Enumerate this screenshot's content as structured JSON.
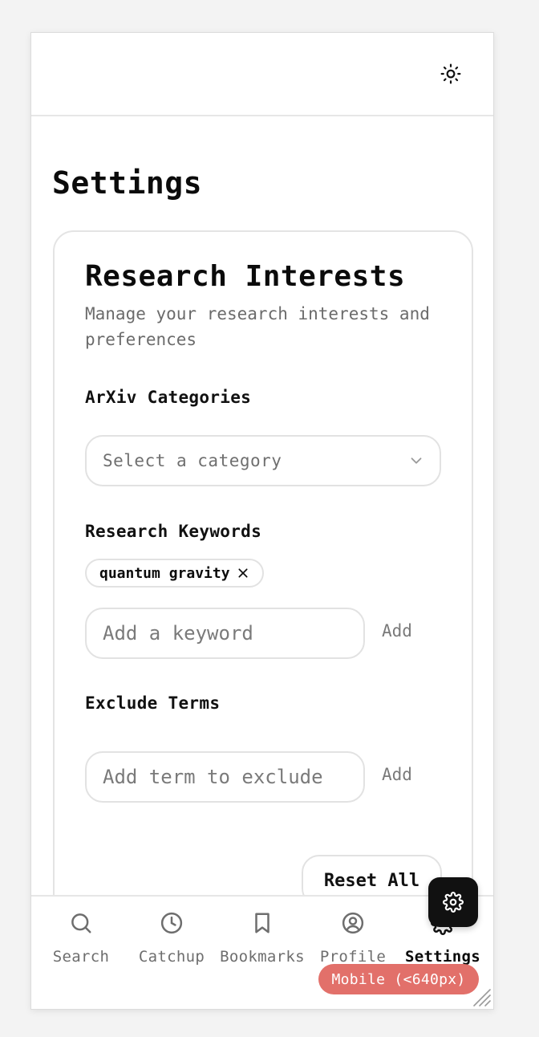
{
  "page": {
    "title": "Settings"
  },
  "topbar": {
    "theme_toggle_icon": "sun-icon"
  },
  "card": {
    "title": "Research Interests",
    "description": "Manage your research interests and preferences"
  },
  "categories": {
    "label": "ArXiv Categories",
    "select_placeholder": "Select a category",
    "select_icon": "chevron-down-icon"
  },
  "keywords": {
    "label": "Research Keywords",
    "chips": [
      {
        "label": "quantum gravity",
        "remove_icon": "close-icon"
      }
    ],
    "input_placeholder": "Add a keyword",
    "input_value": "",
    "add_label": "Add"
  },
  "exclude": {
    "label": "Exclude Terms",
    "input_placeholder": "Add term to exclude",
    "input_value": "",
    "add_label": "Add"
  },
  "actions": {
    "reset_label": "Reset All"
  },
  "bottom_nav": {
    "items": [
      {
        "label": "Search",
        "icon": "search-icon",
        "active": false
      },
      {
        "label": "Catchup",
        "icon": "clock-icon",
        "active": false
      },
      {
        "label": "Bookmarks",
        "icon": "bookmark-icon",
        "active": false
      },
      {
        "label": "Profile",
        "icon": "user-circle-icon",
        "active": false
      },
      {
        "label": "Settings",
        "icon": "gear-icon",
        "active": true
      }
    ]
  },
  "fab": {
    "icon": "gear-icon"
  },
  "viewport_badge": {
    "label": "Mobile (<640px)",
    "color": "#e2706a"
  },
  "colors": {
    "text": "#0b0b0b",
    "muted": "#6b6b6b",
    "border": "#e2e2e2",
    "fab_bg": "#111111"
  }
}
